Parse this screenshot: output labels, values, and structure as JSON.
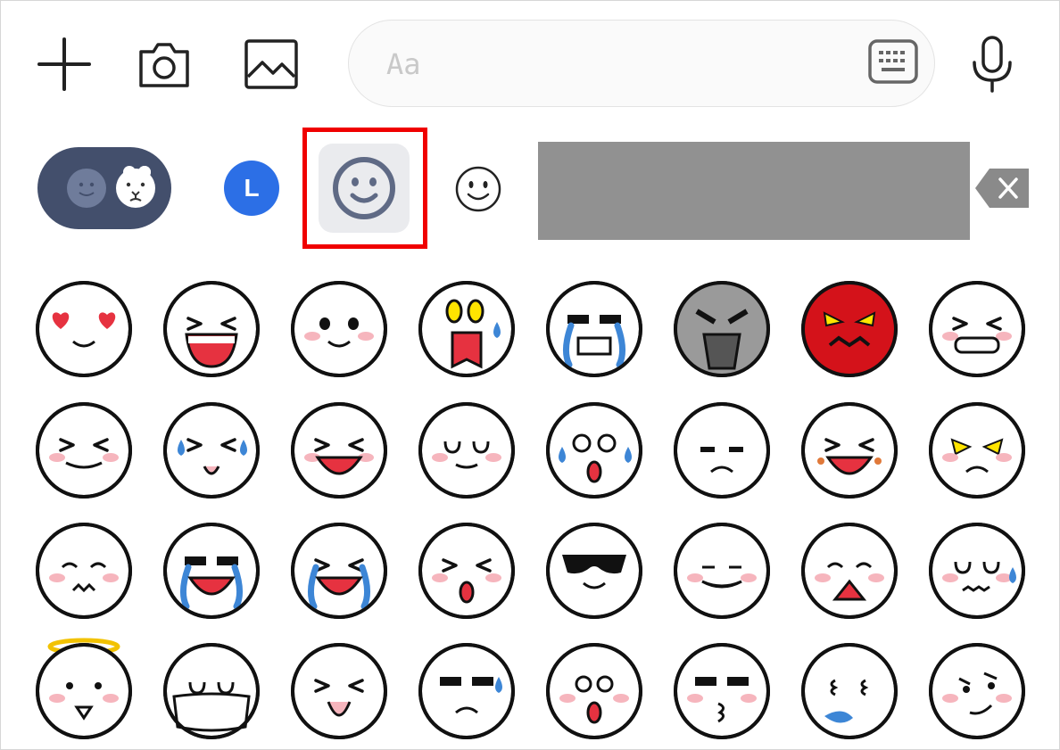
{
  "toolbar": {
    "add_icon": "plus-icon",
    "camera_icon": "camera-icon",
    "gallery_icon": "image-icon",
    "mic_icon": "microphone-icon"
  },
  "message_input": {
    "placeholder": "Aa",
    "keyboard_icon": "keyboard-icon"
  },
  "tabs": [
    {
      "name": "stickers",
      "icon": "sticker-pack-icon"
    },
    {
      "name": "line",
      "label": "L"
    },
    {
      "name": "emoji",
      "icon": "smiley-icon",
      "selected": true
    },
    {
      "name": "emoji-basic",
      "icon": "smiley-icon"
    }
  ],
  "delete_icon": "backspace-icon",
  "colors": {
    "pill_bg": "#434f6c",
    "line_blue": "#2c6fe6",
    "highlight": "#f00000",
    "redaction": "#919191"
  },
  "emoticons": [
    "heart-eyes",
    "big-laugh",
    "teary-smile",
    "shocked-sweat",
    "crying-hard",
    "scary-grey",
    "red-angry",
    "grinning-teeth",
    "squint-grin",
    "tongue-sweat",
    "wink-laugh",
    "content-smile",
    "shocked-tears",
    "sad-frown",
    "screaming-ash",
    "angry-yellow-eyes",
    "annoyed-grumble",
    "laughing-tears",
    "wailing-tears",
    "gasp-squint",
    "sunglasses",
    "tongue-out-smile",
    "distressed",
    "worried-sweat",
    "angel-halo",
    "face-mask",
    "tongue-tease",
    "sweaty-sad",
    "surprised",
    "kiss-cool",
    "sneeze-drip",
    "smirk"
  ]
}
